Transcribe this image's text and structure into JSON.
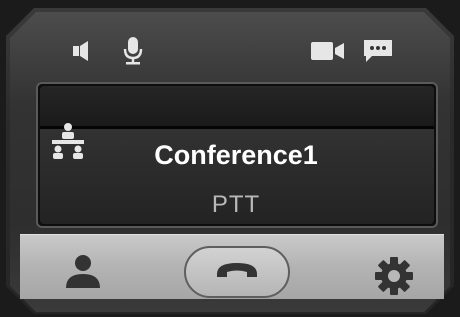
{
  "conference": {
    "name": "Conference1",
    "mode": "PTT"
  },
  "icons": {
    "speaker": "speaker-icon",
    "microphone": "microphone-icon",
    "video": "video-camera-icon",
    "message": "message-icon",
    "conference": "conference-group-icon",
    "contact": "contact-person-icon",
    "hangup": "hangup-phone-icon",
    "settings": "gear-icon"
  },
  "colors": {
    "screen_bg": "#0e0e0e",
    "name_text": "#ffffff",
    "mode_text": "#b8b8b8",
    "icon_light": "#e6e6e6",
    "icon_dark": "#333333",
    "control_bar": "#b3b3b3"
  }
}
